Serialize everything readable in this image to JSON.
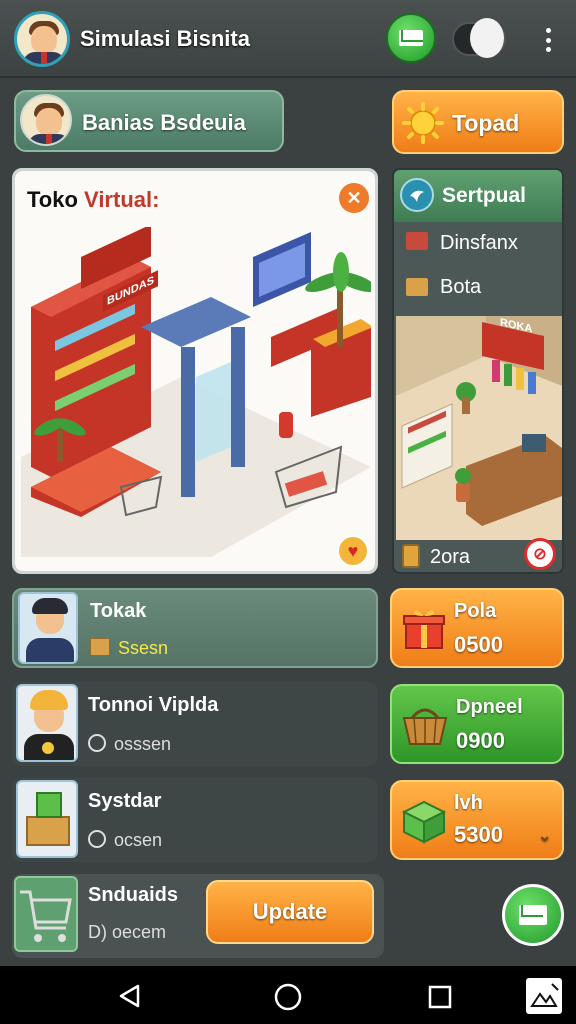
{
  "header": {
    "title": "Simulasi Bisnita",
    "avatar_icon": "businessman-avatar-icon",
    "mail_icon": "mail-icon",
    "toggle_icon": "profile-toggle-icon",
    "menu_icon": "more-vert-icon"
  },
  "profile_bar": {
    "label": "Banias Bsdeuia"
  },
  "top_button": {
    "label": "Topad",
    "icon": "sun-coin-icon"
  },
  "main_card": {
    "title_part1": "Toko",
    "title_part2": "Virtual:",
    "close_icon": "close-icon",
    "heart_icon": "heart-icon",
    "store_sign": "BUNDAS",
    "scene_icon": "isometric-store-illustration"
  },
  "side_panel": {
    "header": "Sertpual",
    "item1": "Dinsfanx",
    "item2": "Bota",
    "store_sign": "ROKA",
    "footer_label": "2ora",
    "scene_icon": "isometric-shop-interior-illustration"
  },
  "list": [
    {
      "title": "Tokak",
      "subtitle": "Ssesn",
      "sub_icon": "box-icon",
      "avatar": "female-agent-avatar"
    },
    {
      "title": "Tonnoi Viplda",
      "subtitle": "osssen",
      "sub_icon": "clock-icon",
      "avatar": "blonde-player-avatar"
    },
    {
      "title": "Systdar",
      "subtitle": "ocsen",
      "sub_icon": "clock-icon",
      "avatar": "cardboard-box-avatar"
    },
    {
      "title": "Snduaids",
      "subtitle": "D) oecem",
      "avatar": "shopping-cart-avatar"
    }
  ],
  "right_cards": [
    {
      "title": "Pola",
      "value": "0500",
      "icon": "gift-box-icon",
      "color": "#f07d17"
    },
    {
      "title": "Dpneel",
      "value": "0900",
      "icon": "basket-icon",
      "color": "#2e9628"
    },
    {
      "title": "lvh",
      "value": "5300",
      "icon": "green-cube-icon",
      "color": "#f07d17"
    }
  ],
  "update_button": {
    "label": "Update"
  },
  "fab": {
    "icon": "mail-icon"
  },
  "navbar": {
    "back_icon": "back-triangle-icon",
    "home_icon": "home-circle-icon",
    "recents_icon": "recents-square-icon",
    "extra_icon": "image-edit-icon"
  },
  "colors": {
    "orange": "#f07d17",
    "green": "#2e9628",
    "teal": "#2fa0b8",
    "bg": "#3a4140"
  }
}
